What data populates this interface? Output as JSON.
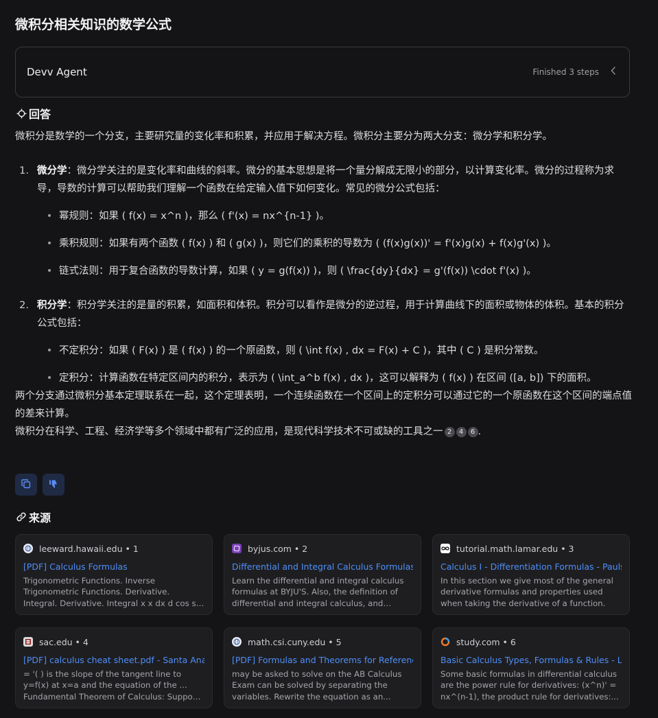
{
  "page": {
    "title": "微积分相关知识的数学公式"
  },
  "agent": {
    "name": "Devv Agent",
    "status": "Finished 3 steps",
    "toggle_icon": "chevron-left-icon"
  },
  "answer": {
    "heading": "回答",
    "intro": "微积分是数学的一个分支，主要研究量的变化率和积累，并应用于解决方程。微积分主要分为两大分支：微分学和积分学。",
    "items": [
      {
        "num": "1.",
        "term": "微分学",
        "text": "：微分学关注的是变化率和曲线的斜率。微分的基本思想是将一个量分解成无限小的部分，以计算变化率。微分的过程称为求导，导数的计算可以帮助我们理解一个函数在给定输入值下如何变化。常见的微分公式包括：",
        "subs": [
          "幂规则：如果 ( f(x) = x^n )，那么 ( f'(x) = nx^{n-1} )。",
          "乘积规则：如果有两个函数 ( f(x) ) 和 ( g(x) )，则它们的乘积的导数为 ( (f(x)g(x))' = f'(x)g(x) + f(x)g'(x) )。",
          "链式法则：用于复合函数的导数计算，如果 ( y = g(f(x)) )，则 ( \\frac{dy}{dx} = g'(f(x)) \\cdot f'(x) )。"
        ]
      },
      {
        "num": "2.",
        "term": "积分学",
        "text": "：积分学关注的是量的积累，如面积和体积。积分可以看作是微分的逆过程，用于计算曲线下的面积或物体的体积。基本的积分公式包括：",
        "subs": [
          "不定积分：如果 ( F(x) ) 是 ( f(x) ) 的一个原函数，则 ( \\int f(x) , dx = F(x) + C )，其中 ( C ) 是积分常数。",
          "定积分：计算函数在特定区间内的积分，表示为 ( \\int_a^b f(x) , dx )，这可以解释为 ( f(x) ) 在区间 ([a, b]) 下的面积。"
        ]
      }
    ],
    "para1": "两个分支通过微积分基本定理联系在一起，这个定理表明，一个连续函数在一个区间上的定积分可以通过它的一个原函数在这个区间的端点值的差来计算。",
    "para2": "微积分在科学、工程、经济学等多个领域中都有广泛的应用，是现代科学技术不可或缺的工具之一",
    "citations": [
      "2",
      "4",
      "6"
    ],
    "para2_end": "."
  },
  "actions": {
    "copy_icon": "copy-icon",
    "dislike_icon": "thumbs-down-icon"
  },
  "sources": {
    "heading": "来源",
    "items": [
      {
        "domain": "leeward.hawaii.edu",
        "num": "1",
        "title": "[PDF] Calculus Formulas",
        "snippet": "Trigonometric Functions. Inverse Trigonometric Functions. Derivative. Integral. Derivative. Integral x x dx d cos sin = cx dxx....",
        "icon": "globe-icon"
      },
      {
        "domain": "byjus.com",
        "num": "2",
        "title": "Differential and Integral Calculus Formulas -",
        "snippet": "Learn the differential and integral calculus formulas at BYJU'S. Also, the definition of differential and integral calculus, and more...",
        "icon": "byjus-logo-icon"
      },
      {
        "domain": "tutorial.math.lamar.edu",
        "num": "3",
        "title": "Calculus I - Differentiation Formulas - Pauls",
        "snippet": "In this section we give most of the general derivative formulas and properties used when taking the derivative of a function.",
        "icon": "infinity-icon"
      },
      {
        "domain": "sac.edu",
        "num": "4",
        "title": "[PDF] calculus cheat sheet.pdf - Santa Ana",
        "snippet": "= '( ) is the slope of the tangent line to y=f(x) at x=a and the equation of the ... Fundamental Theorem of Calculus: Suppose ( ) is ...",
        "icon": "sac-logo-icon"
      },
      {
        "domain": "math.csi.cuny.edu",
        "num": "5",
        "title": "[PDF] Formulas and Theorems for Reference",
        "snippet": "may be asked to solve on the AB Calculus Exam can be solved by separating the variables. Rewrite the equation as an...",
        "icon": "globe-icon"
      },
      {
        "domain": "study.com",
        "num": "6",
        "title": "Basic Calculus Types, Formulas & Rules - Le",
        "snippet": "Some basic formulas in differential calculus are the power rule for derivatives: (x^n)' = nx^(n-1), the product rule for derivatives:...",
        "icon": "study-logo-icon"
      }
    ]
  }
}
